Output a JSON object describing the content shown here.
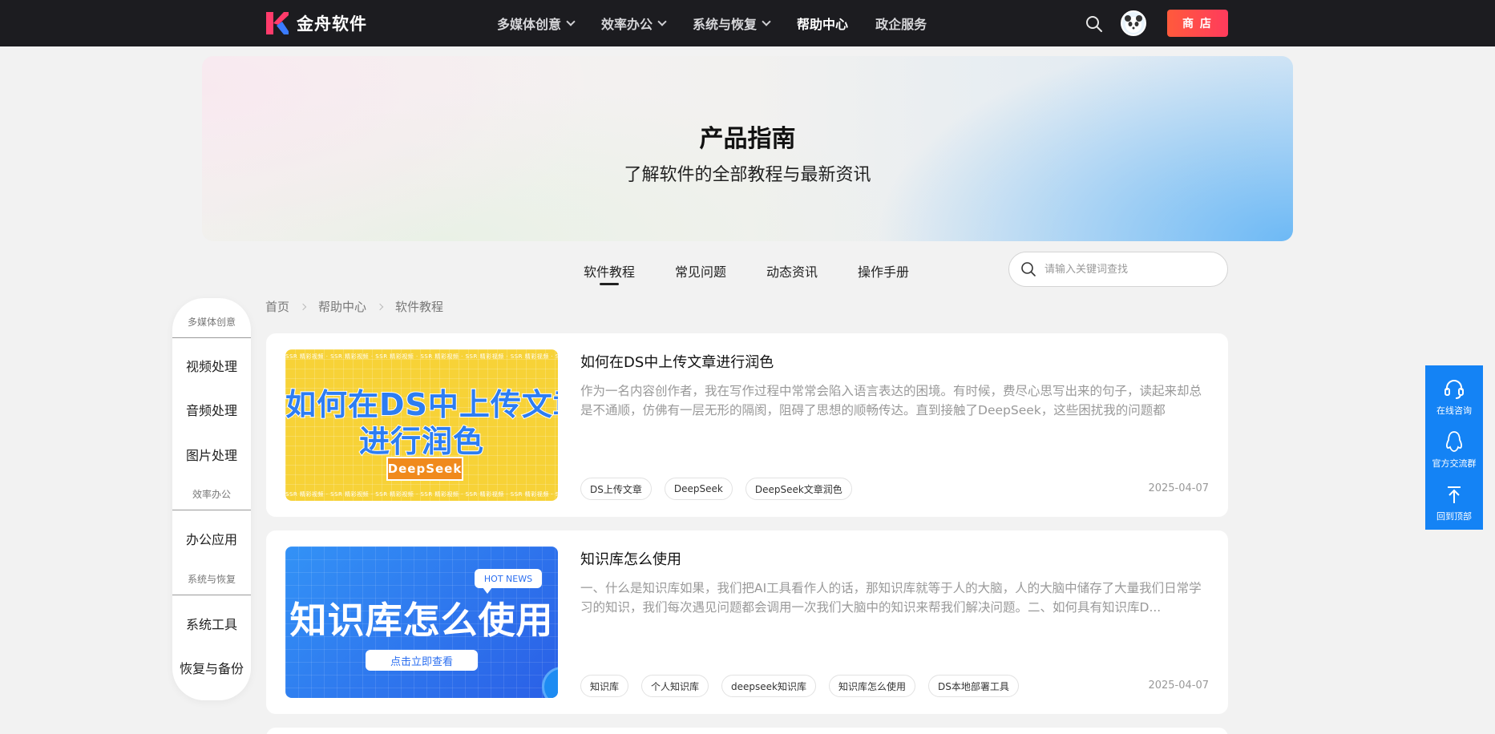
{
  "navbar": {
    "brand": "金舟软件",
    "menu": [
      {
        "label": "多媒体创意",
        "has_dropdown": true
      },
      {
        "label": "效率办公",
        "has_dropdown": true
      },
      {
        "label": "系统与恢复",
        "has_dropdown": true
      },
      {
        "label": "帮助中心",
        "has_dropdown": false,
        "active": true
      },
      {
        "label": "政企服务",
        "has_dropdown": false
      }
    ],
    "shop_label": "商 店"
  },
  "hero": {
    "title": "产品指南",
    "subtitle": "了解软件的全部教程与最新资讯"
  },
  "tabs": [
    {
      "label": "软件教程",
      "active": true
    },
    {
      "label": "常见问题"
    },
    {
      "label": "动态资讯"
    },
    {
      "label": "操作手册"
    }
  ],
  "search": {
    "placeholder": "请输入关键词查找",
    "value": ""
  },
  "breadcrumb": [
    "首页",
    "帮助中心",
    "软件教程"
  ],
  "sidebar": {
    "groups": [
      {
        "title": "多媒体创意",
        "items": [
          "视频处理",
          "音频处理",
          "图片处理"
        ]
      },
      {
        "title": "效率办公",
        "items": [
          "办公应用"
        ]
      },
      {
        "title": "系统与恢复",
        "items": [
          "系统工具",
          "恢复与备份"
        ]
      }
    ]
  },
  "articles": [
    {
      "title": "如何在DS中上传文章进行润色",
      "desc": "作为一名内容创作者，我在写作过程中常常会陷入语言表达的困境。有时候，费尽心思写出来的句子，读起来却总是不通顺，仿佛有一层无形的隔阂，阻碍了思想的顺畅传达。直到接触了DeepSeek，这些困扰我的问题都",
      "tags": [
        "DS上传文章",
        "DeepSeek",
        "DeepSeek文章润色"
      ],
      "date": "2025-04-07",
      "thumb": {
        "line1": "如何在DS中上传文章",
        "line2": "进行润色",
        "badge": "DeepSeek",
        "strip": "SSR 精彩视频 · SSR 精彩视频 · SSR 精彩视频 · SSR 精彩视频 · SSR 精彩视频 · SSR 精彩视频 · SSR 精彩视频"
      }
    },
    {
      "title": "知识库怎么使用",
      "desc": "一、什么是知识库如果，我们把AI工具看作人的话，那知识库就等于人的大脑，人的大脑中储存了大量我们日常学习的知识，我们每次遇见问题都会调用一次我们大脑中的知识来帮我们解决问题。二、如何具有知识库D...",
      "tags": [
        "知识库",
        "个人知识库",
        "deepseek知识库",
        "知识库怎么使用",
        "DS本地部署工具"
      ],
      "date": "2025-04-07",
      "thumb": {
        "big": "知识库怎么使用",
        "hot": "HOT NEWS",
        "cta": "点击立即查看"
      }
    }
  ],
  "float_bar": [
    "在线咨询",
    "官方交流群",
    "回到顶部"
  ],
  "colors": {
    "nav_bg": "#1c1c20",
    "shop_btn": "#ff4b4b",
    "float_bg": "#1483f5",
    "accent_blue": "#2d7df2"
  }
}
